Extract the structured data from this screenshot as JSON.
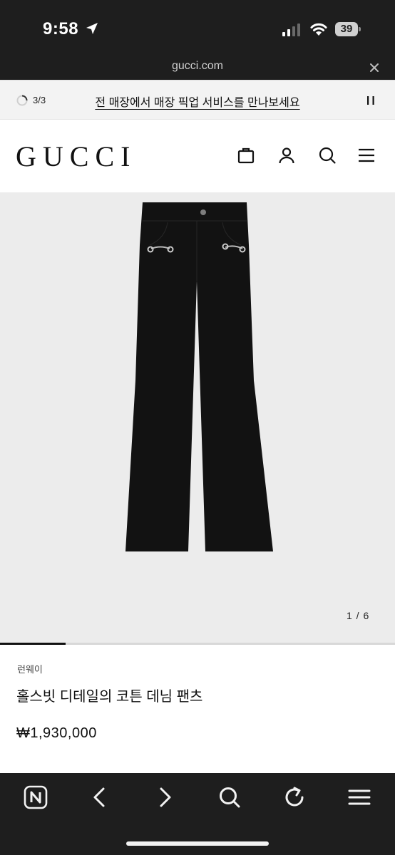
{
  "status_bar": {
    "time": "9:58",
    "battery": "39",
    "icons": [
      "location-arrow-icon",
      "cellular-signal-icon",
      "wifi-icon",
      "battery-icon"
    ]
  },
  "browser": {
    "url": "gucci.com",
    "close_icon": "close-icon"
  },
  "promo": {
    "counter": "3/3",
    "text": "전 매장에서 매장 픽업 서비스를 만나보세요",
    "pause_icon": "pause-icon"
  },
  "header": {
    "logo": "GUCCI",
    "icons": [
      "shopping-bag-icon",
      "user-icon",
      "search-icon",
      "menu-icon"
    ]
  },
  "gallery": {
    "counter": "1 / 6",
    "progress": 0.1667
  },
  "product": {
    "category": "런웨이",
    "name": "홀스빗 디테일의 코튼 데님 팬츠",
    "price": "₩1,930,000"
  },
  "toolbar": {
    "buttons": [
      "naver-home-icon",
      "back-icon",
      "forward-icon",
      "search-icon",
      "reload-icon",
      "menu-icon"
    ]
  },
  "colors": {
    "chrome": "#1e1e1e",
    "promo_bg": "#f3f3f3",
    "gallery_bg": "#ececec",
    "text": "#111111"
  }
}
